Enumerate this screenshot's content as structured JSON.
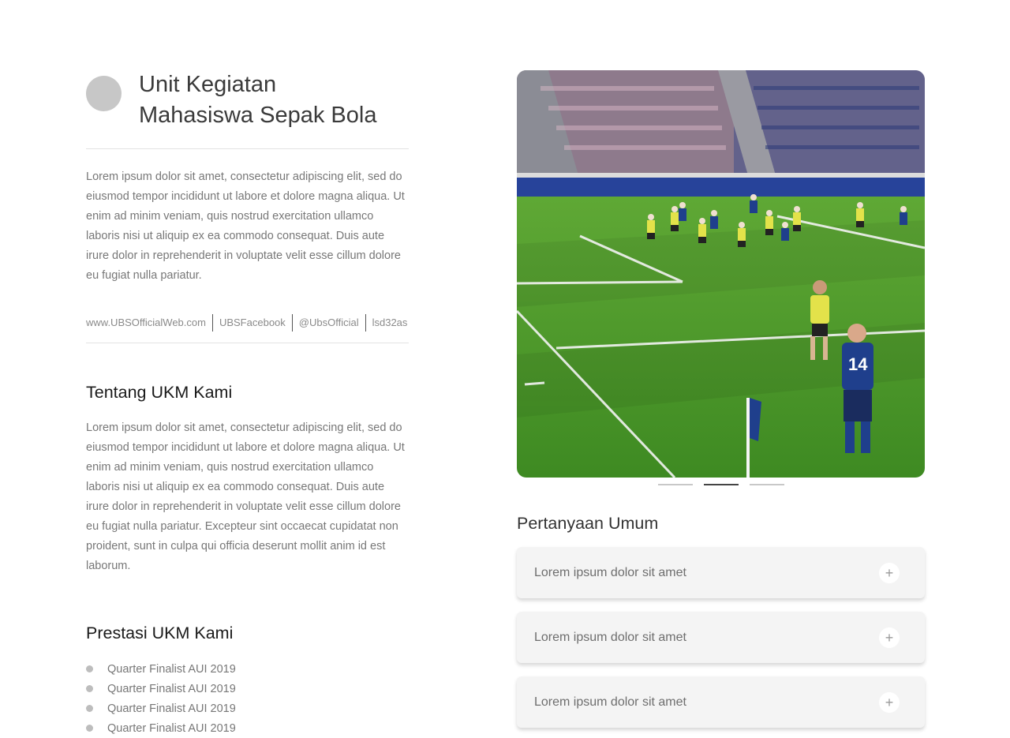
{
  "club": {
    "title_line1": "Unit Kegiatan",
    "title_line2": "Mahasiswa Sepak Bola",
    "description": "Lorem ipsum dolor sit amet, consectetur adipiscing elit, sed do eiusmod tempor incididunt ut labore et dolore magna aliqua. Ut enim ad minim veniam, quis nostrud exercitation ullamco laboris nisi ut aliquip ex ea commodo consequat. Duis aute irure dolor in reprehenderit in voluptate velit esse cillum dolore eu fugiat nulla pariatur."
  },
  "links": {
    "website": "www.UBSOfficialWeb.com",
    "facebook": "UBSFacebook",
    "instagram": "@UbsOfficial",
    "line": "lsd32as"
  },
  "about": {
    "heading": "Tentang UKM Kami",
    "text": "Lorem ipsum dolor sit amet, consectetur adipiscing elit, sed do eiusmod tempor incididunt ut labore et dolore magna aliqua. Ut enim ad minim veniam, quis nostrud exercitation ullamco laboris nisi ut aliquip ex ea commodo consequat. Duis aute irure dolor in reprehenderit in voluptate velit esse cillum dolore eu fugiat nulla pariatur. Excepteur sint occaecat cupidatat non proident, sunt in culpa qui officia deserunt mollit anim id est laborum."
  },
  "achievements": {
    "heading": "Prestasi UKM Kami",
    "items": [
      "Quarter Finalist AUI 2019",
      "Quarter Finalist AUI 2019",
      "Quarter Finalist AUI 2019",
      "Quarter Finalist AUI 2019"
    ]
  },
  "carousel": {
    "active_index": 1,
    "slide_count": 3
  },
  "faq": {
    "heading": "Pertanyaan Umum",
    "items": [
      "Lorem ipsum dolor sit amet",
      "Lorem ipsum dolor sit amet",
      "Lorem ipsum dolor sit amet"
    ],
    "expand_icon": "plus-icon"
  },
  "colors": {
    "pitch": "#4f9a2c",
    "home_kit": "#1f3f8c",
    "away_kit": "#e3e24a"
  }
}
